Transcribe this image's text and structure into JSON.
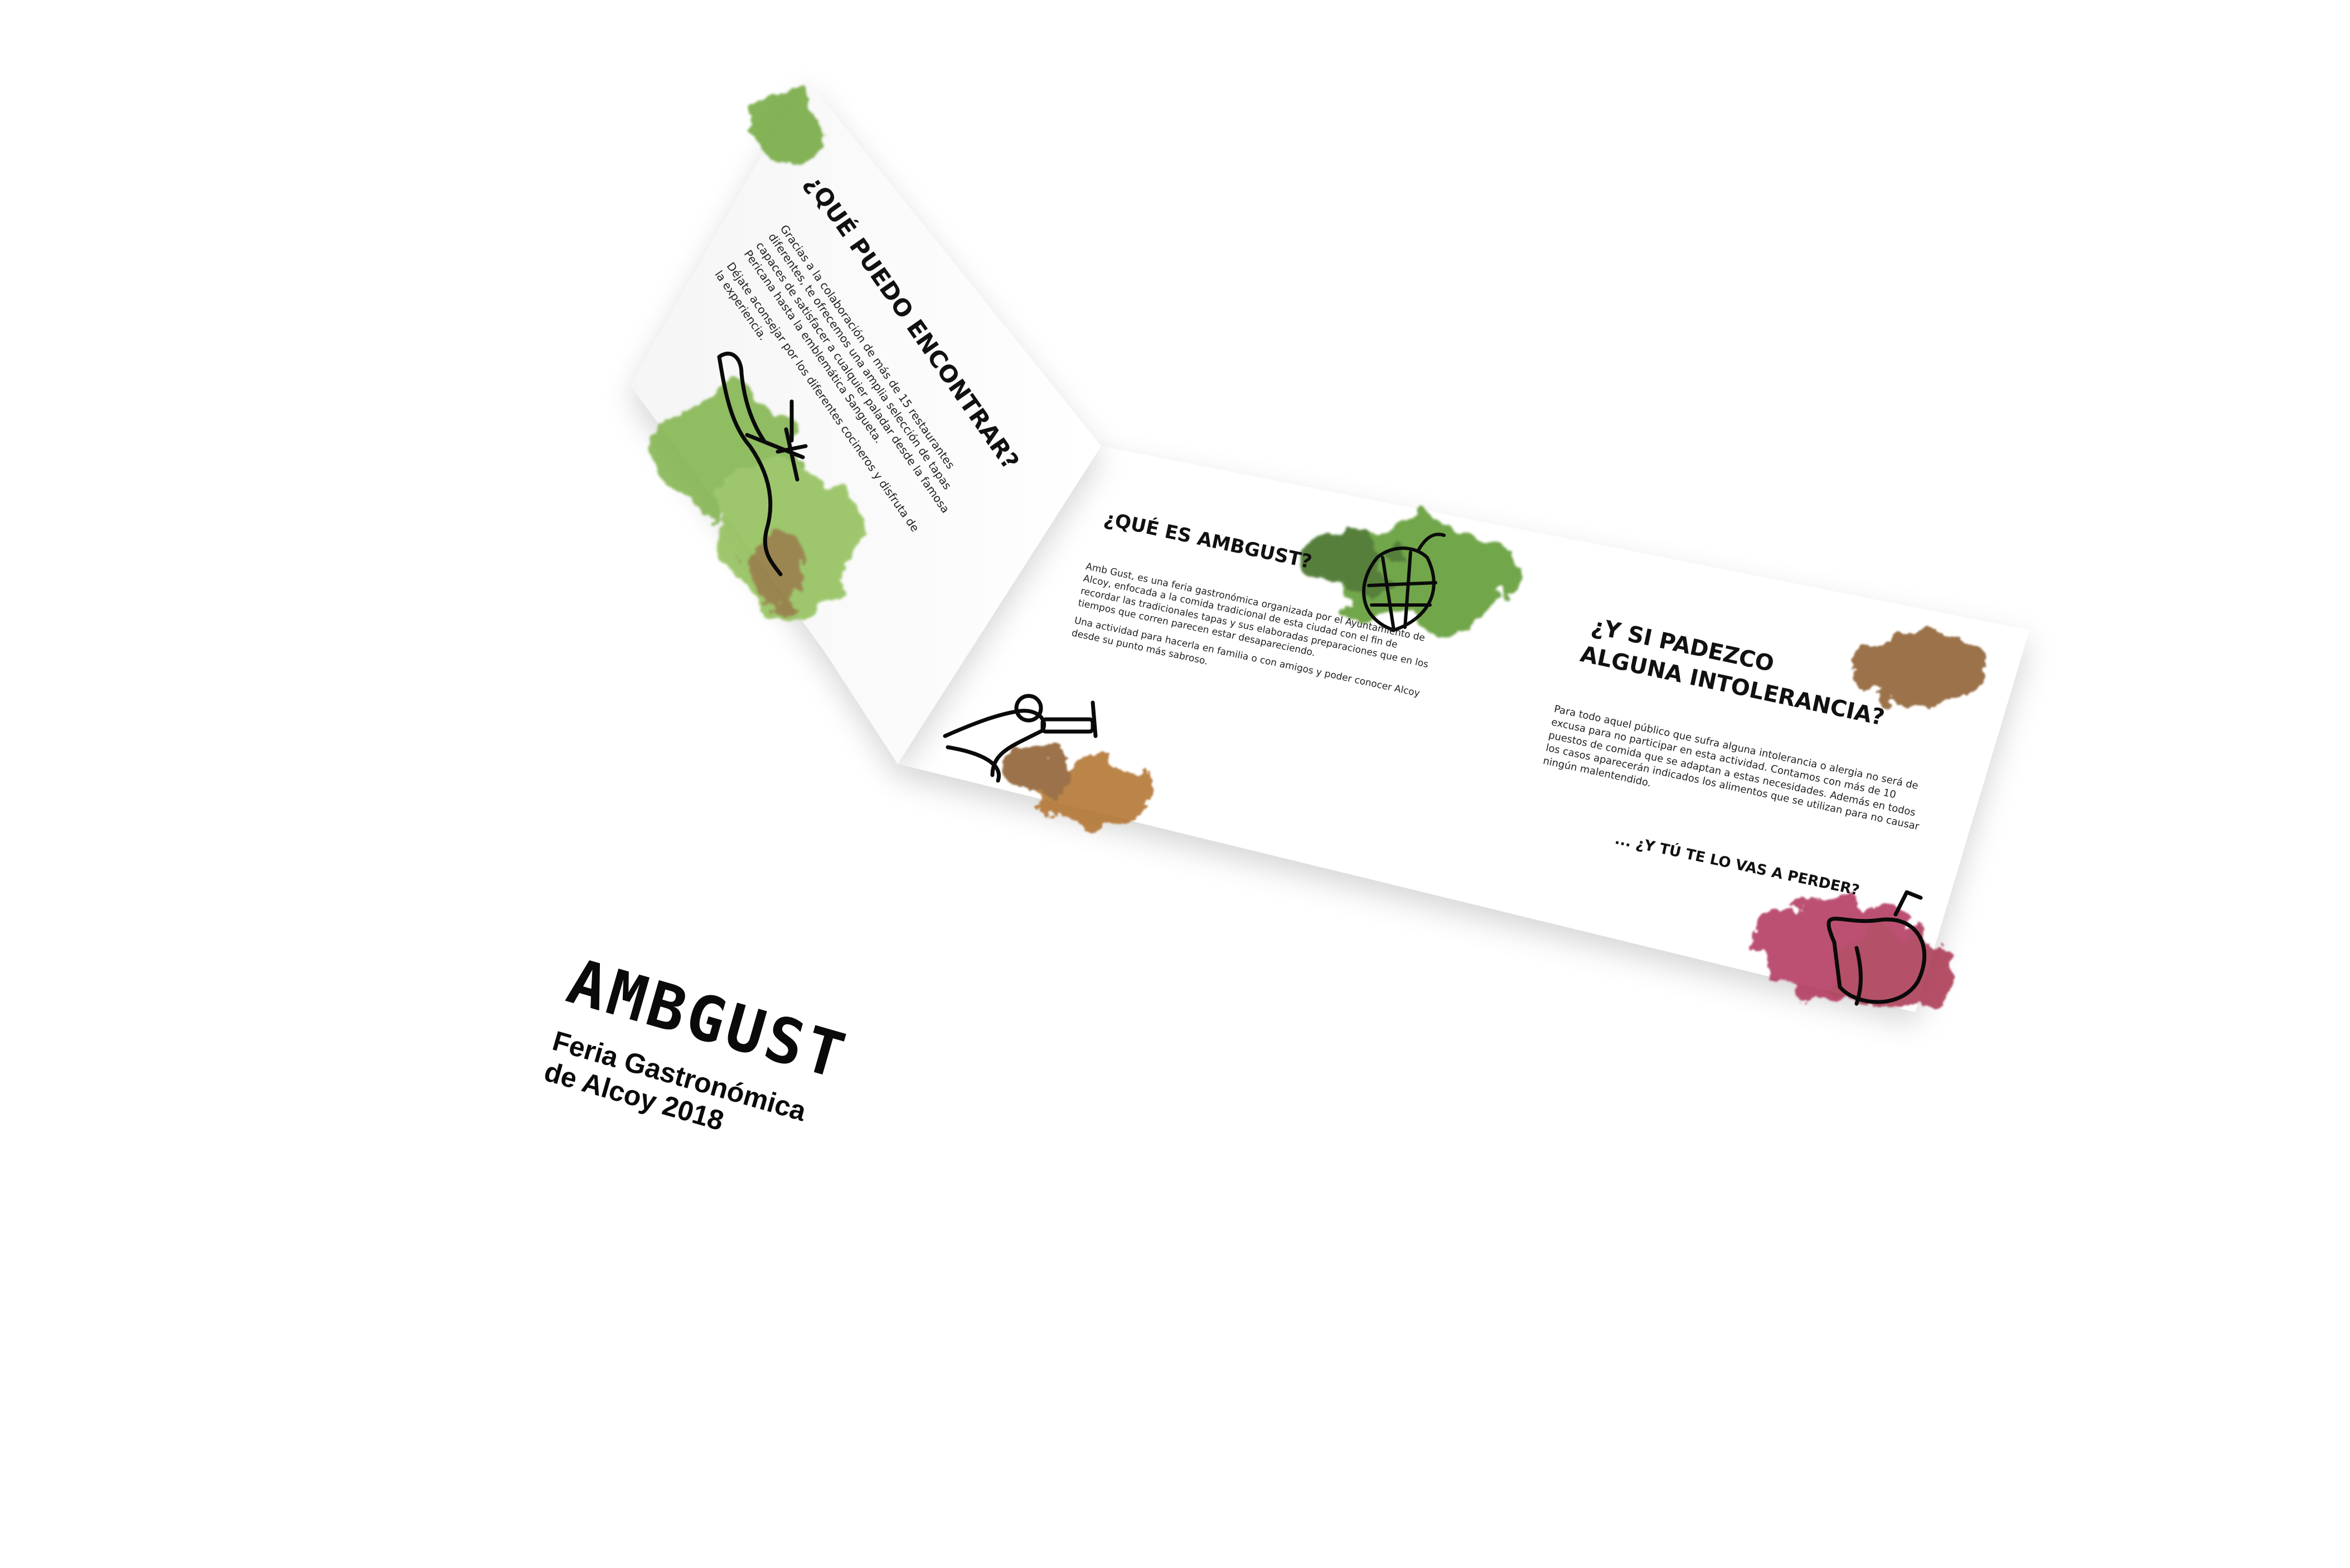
{
  "brochure": {
    "left_page": {
      "heading": "¿QUÉ PUEDO ENCONTRAR?",
      "body": [
        "Gracias a la colaboración de más de 15 restaurantes diferentes, te ofrecemos una amplia selección de tapas capaces de satisfacer a cualquier paladar desde la famosa Pericana hasta la emblemática Sangueta.",
        "Déjate aconsejar por los diferentes cocineros y disfruta de la experiencia."
      ]
    },
    "center_page": {
      "heading": "¿QUÉ ES AMBGUST?",
      "body": [
        "Amb Gust, es una feria gastronómica organizada por el Ayuntamiento de Alcoy, enfocada a la comida tradicional de esta ciudad con el fin de recordar las tradicionales tapas y sus elaboradas preparaciones que en los tiempos que corren parecen estar desapareciendo.",
        "Una actividad para hacerla en familia o con amigos y poder conocer Alcoy desde su punto más sabroso."
      ]
    },
    "right_page": {
      "heading_line1": "¿Y SI PADEZCO",
      "heading_line2": "ALGUNA INTOLERANCIA?",
      "body": "Para todo aquel público que sufra alguna intolerancia o alergia no será de excusa para no participar en esta actividad. Contamos con más de 10 puestos de comida que se adaptan a estas necesidades. Además en todos los casos aparecerán indicados los alimentos que se utilizan para no causar ningún malentendido.",
      "closing": "... ¿Y TÚ TE LO VAS A PERDER?"
    }
  },
  "front_cover": {
    "logo": "AMBGUST",
    "subtitle_line1": "Feria Gastronómica",
    "subtitle_line2": "de Alcoy 2018"
  },
  "back_cover": {},
  "colors": {
    "background": "#ffffff",
    "paper": "#ffffff",
    "ink": "#0a0a0a",
    "watercolor_green": "#6fa63a",
    "watercolor_dark_green": "#3f6e22",
    "watercolor_brown": "#8a5a2a",
    "watercolor_wine": "#a8324e",
    "watercolor_magenta": "#b0305a"
  },
  "icons": [
    "hand-holding-skewer-icon",
    "artichoke-icon",
    "hand-holding-plate-icon",
    "tomato-icon",
    "spoon-icon"
  ]
}
